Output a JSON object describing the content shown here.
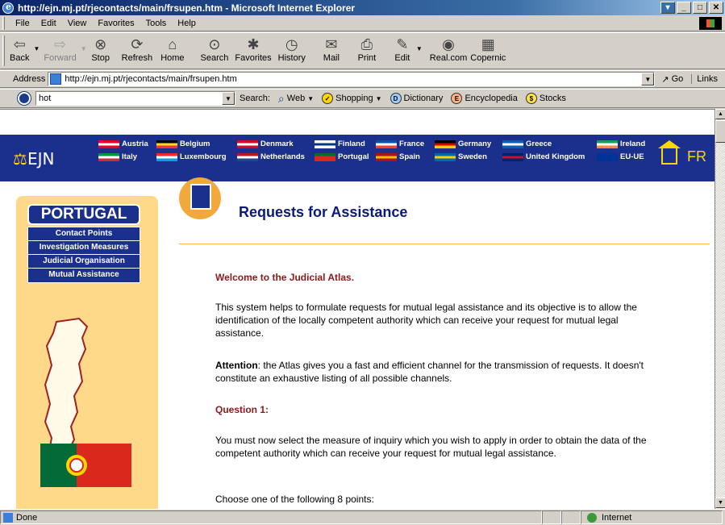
{
  "window": {
    "title": "http://ejn.mj.pt/rjecontacts/main/frsupen.htm - Microsoft Internet Explorer",
    "controls": [
      "▾",
      "_",
      "□",
      "✕"
    ]
  },
  "menu": [
    "File",
    "Edit",
    "View",
    "Favorites",
    "Tools",
    "Help"
  ],
  "toolbar": {
    "back": "Back",
    "forward": "Forward",
    "stop": "Stop",
    "refresh": "Refresh",
    "home": "Home",
    "search": "Search",
    "favorites": "Favorites",
    "history": "History",
    "mail": "Mail",
    "print": "Print",
    "edit": "Edit",
    "realcom": "Real.com",
    "copernic": "Copernic"
  },
  "address": {
    "label": "Address",
    "value": "http://ejn.mj.pt/rjecontacts/main/frsupen.htm",
    "go": "Go",
    "links": "Links"
  },
  "searchbar": {
    "query": "hot",
    "label": "Search:",
    "web": "Web",
    "shopping": "Shopping",
    "dictionary": "Dictionary",
    "encyclopedia": "Encyclopedia",
    "stocks": "Stocks"
  },
  "ejn": {
    "logo_symbol": "⚖",
    "logo_text": "EJN",
    "fr": "FR",
    "countries": [
      {
        "name": "Austria",
        "colors": [
          "#e4002b",
          "#ffffff",
          "#e4002b"
        ]
      },
      {
        "name": "Belgium",
        "colors": [
          "#000000",
          "#fdda24",
          "#ef3340"
        ]
      },
      {
        "name": "Denmark",
        "colors": [
          "#c8102e",
          "#ffffff",
          "#c8102e"
        ]
      },
      {
        "name": "Finland",
        "colors": [
          "#ffffff",
          "#003580",
          "#ffffff"
        ]
      },
      {
        "name": "France",
        "colors": [
          "#0055a4",
          "#ffffff",
          "#ef4135"
        ]
      },
      {
        "name": "Germany",
        "colors": [
          "#000000",
          "#dd0000",
          "#ffce00"
        ]
      },
      {
        "name": "Greece",
        "colors": [
          "#0d5eaf",
          "#ffffff",
          "#0d5eaf"
        ]
      },
      {
        "name": "Ireland",
        "colors": [
          "#169b62",
          "#ffffff",
          "#ff883e"
        ]
      },
      {
        "name": "Italy",
        "colors": [
          "#009246",
          "#ffffff",
          "#ce2b37"
        ]
      },
      {
        "name": "Luxembourg",
        "colors": [
          "#ed2939",
          "#ffffff",
          "#00a1de"
        ]
      },
      {
        "name": "Netherlands",
        "colors": [
          "#ae1c28",
          "#ffffff",
          "#21468b"
        ]
      },
      {
        "name": "Portugal",
        "colors": [
          "#046a38",
          "#da291c",
          "#da291c"
        ]
      },
      {
        "name": "Spain",
        "colors": [
          "#aa151b",
          "#f1bf00",
          "#aa151b"
        ]
      },
      {
        "name": "Sweden",
        "colors": [
          "#006aa7",
          "#fecc00",
          "#006aa7"
        ]
      },
      {
        "name": "United Kingdom",
        "colors": [
          "#012169",
          "#c8102e",
          "#012169"
        ]
      },
      {
        "name": "EU-UE",
        "colors": [
          "#003399",
          "#003399",
          "#003399"
        ]
      }
    ]
  },
  "sidebar": {
    "country": "PORTUGAL",
    "nav": [
      "Contact Points",
      "Investigation Measures",
      "Judicial Organisation",
      "Mutual Assistance"
    ]
  },
  "main": {
    "title": "Requests for Assistance",
    "welcome": "Welcome to the Judicial Atlas.",
    "intro": "This system helps to formulate requests for mutual legal assistance and its objective is to allow the identification of the locally competent authority which can receive your request for mutual legal assistance.",
    "attention_label": "Attention",
    "attention": ": the Atlas gives you a fast and efficient channel for the transmission of requests. It doesn't constitute an exhaustive listing of all possible channels.",
    "question": "Question 1:",
    "question_text": "You must now select the measure of inquiry which you wish to apply in order to obtain the data of the competent authority which can receive your request for mutual legal assistance.",
    "choose": "Choose one of the following 8 points:"
  },
  "status": {
    "text": "Done",
    "zone": "Internet"
  }
}
